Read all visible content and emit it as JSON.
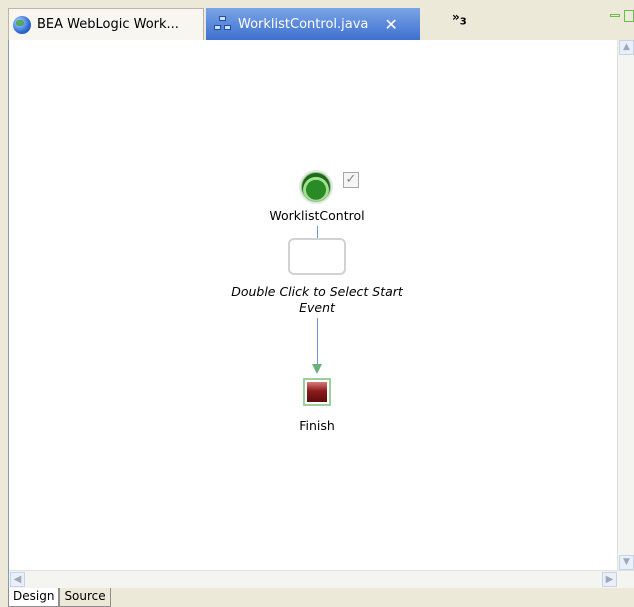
{
  "tabs": {
    "inactive_label": "BEA WebLogic Work...",
    "active_label": "WorklistControl.java",
    "close_glyph": "✕",
    "overflow_glyph": "»",
    "overflow_count": "3"
  },
  "diagram": {
    "control_label": "WorklistControl",
    "event_label_line1": "Double Click to Select Start",
    "event_label_line2": "Event",
    "finish_label": "Finish",
    "check_glyph": "✓"
  },
  "scroll": {
    "up": "▲",
    "down": "▼",
    "left": "◀",
    "right": "▶"
  },
  "bottom_tabs": [
    "Design",
    "Source"
  ],
  "colors": {
    "active_tab": "#3d6fcf",
    "start_node": "#2a8a25",
    "finish_node": "#8c1c1c",
    "connector": "#6a96d8"
  }
}
